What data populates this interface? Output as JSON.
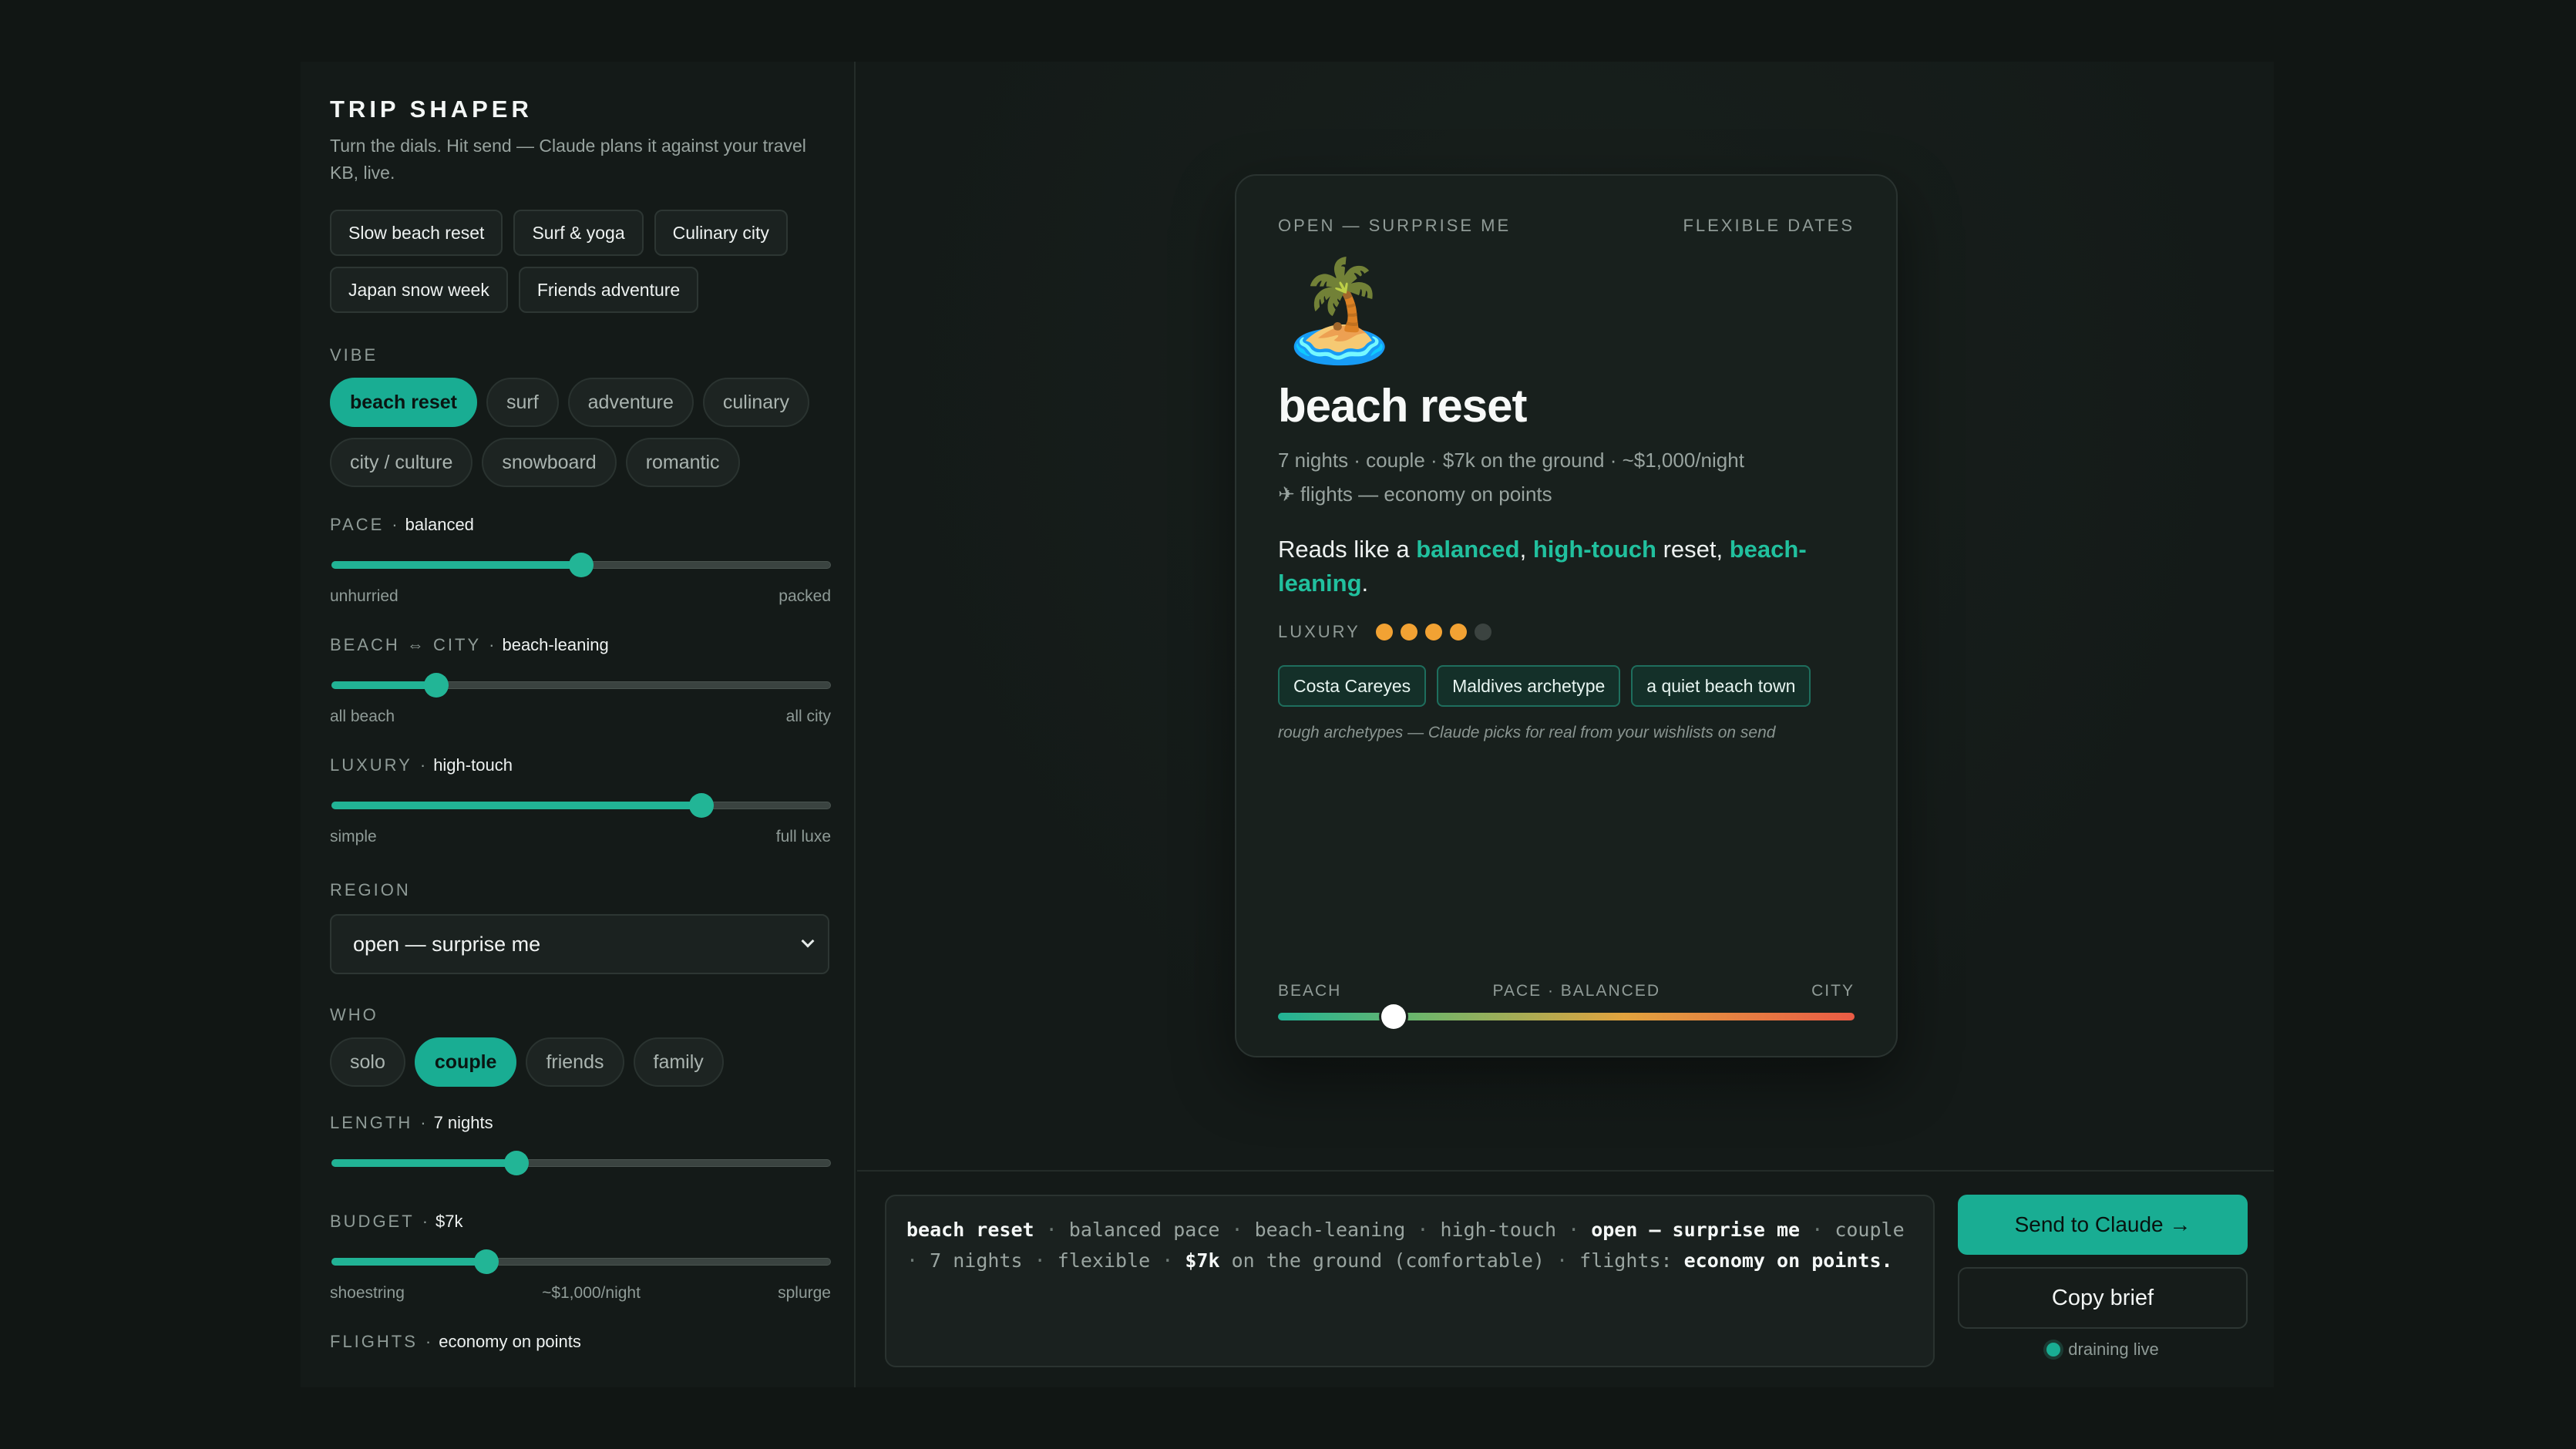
{
  "sidebar": {
    "title": "TRIP SHAPER",
    "subtitle": "Turn the dials. Hit send — Claude plans it against your travel KB, live.",
    "presets": [
      "Slow beach reset",
      "Surf & yoga",
      "Culinary city",
      "Japan snow week",
      "Friends adventure"
    ],
    "vibe": {
      "label": "VIBE",
      "options": [
        "beach reset",
        "surf",
        "adventure",
        "culinary",
        "city / culture",
        "snowboard",
        "romantic"
      ],
      "selected": "beach reset"
    },
    "pace": {
      "label": "PACE",
      "value_label": "balanced",
      "value": 0.5,
      "min_label": "unhurried",
      "max_label": "packed"
    },
    "beach_city": {
      "label": "BEACH ⇔ CITY",
      "value_label": "beach-leaning",
      "value": 0.21,
      "min_label": "all beach",
      "max_label": "all city"
    },
    "luxury": {
      "label": "LUXURY",
      "value_label": "high-touch",
      "value": 0.74,
      "min_label": "simple",
      "max_label": "full luxe"
    },
    "region": {
      "label": "REGION",
      "value": "open — surprise me"
    },
    "who": {
      "label": "WHO",
      "options": [
        "solo",
        "couple",
        "friends",
        "family"
      ],
      "selected": "couple"
    },
    "length": {
      "label": "LENGTH",
      "value_label": "7 nights",
      "value": 0.37
    },
    "budget": {
      "label": "BUDGET",
      "value_label": "$7k",
      "value": 0.31,
      "min_label": "shoestring",
      "mid_label": "~$1,000/night",
      "max_label": "splurge"
    },
    "flights": {
      "label": "FLIGHTS",
      "value_label": "economy on points"
    }
  },
  "card": {
    "region": "OPEN — SURPRISE ME",
    "dates": "FLEXIBLE DATES",
    "emoji": "🏝️",
    "title": "beach reset",
    "meta": "7 nights · couple · $7k on the ground · ~$1,000/night",
    "flights": "✈ flights — economy on points",
    "reads_prefix": "Reads like a ",
    "reads_pace": "balanced",
    "reads_comma": ", ",
    "reads_luxury": "high-touch",
    "reads_mid": " reset, ",
    "reads_beach": "beach-leaning",
    "reads_end": ".",
    "luxury_label": "LUXURY",
    "luxury_rating": 4,
    "luxury_max": 5,
    "tags": [
      "Costa Careyes",
      "Maldives archetype",
      "a quiet beach town"
    ],
    "note": "rough archetypes — Claude picks for real from your wishlists on send",
    "gauge": {
      "left": "BEACH",
      "center": "PACE · BALANCED",
      "right": "CITY",
      "value": 0.2
    }
  },
  "brief": {
    "vibe": "beach reset",
    "pace": "balanced pace",
    "beach_city": "beach-leaning",
    "luxury": "high-touch",
    "region": "open — surprise me",
    "who": "couple",
    "length": "7 nights",
    "dates": "flexible",
    "budget": "$7k",
    "budget_rest": "on the ground (comfortable)",
    "flights_label": "flights:",
    "flights": "economy on points.",
    "sep": "·"
  },
  "actions": {
    "send_label": "Send to Claude →",
    "copy_label": "Copy brief",
    "status": "draining live"
  },
  "colors": {
    "accent": "#19ad93",
    "star": "#f2a233",
    "background": "#111614"
  }
}
